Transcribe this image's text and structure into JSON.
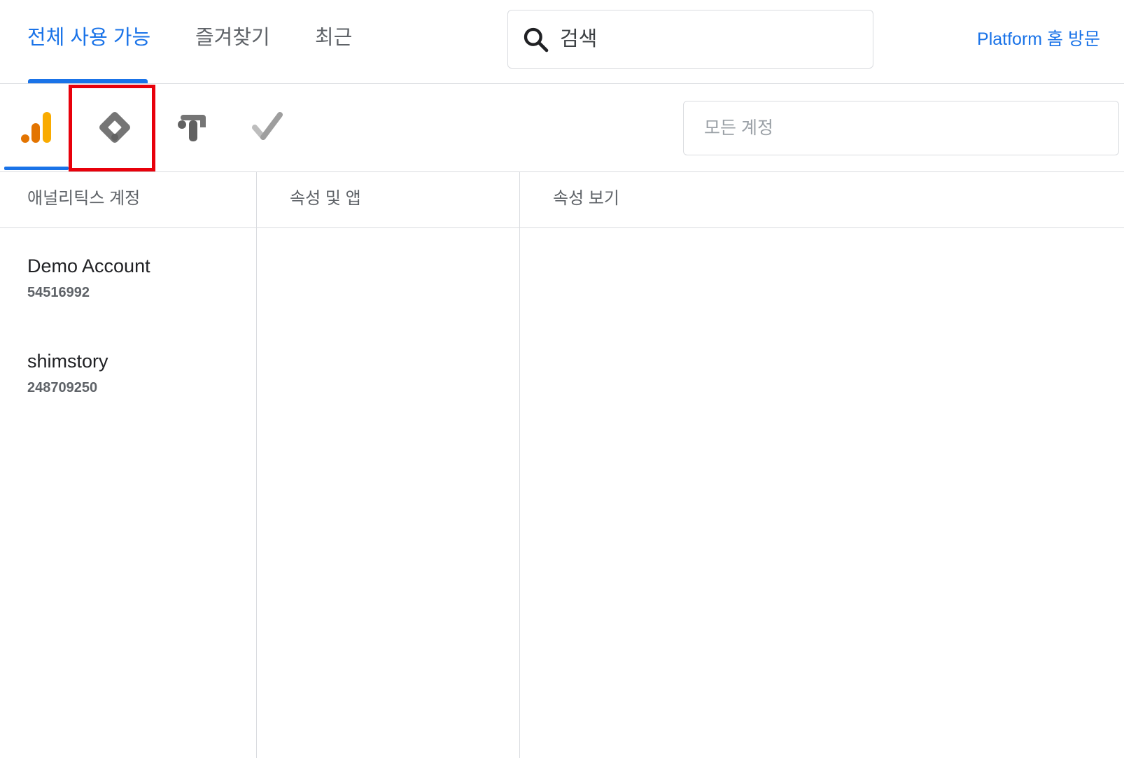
{
  "top_tabs": [
    {
      "label": "전체 사용 가능",
      "active": true
    },
    {
      "label": "즐겨찾기",
      "active": false
    },
    {
      "label": "최근",
      "active": false
    }
  ],
  "search": {
    "placeholder": "검색",
    "icon": "search-icon"
  },
  "platform_link": "Platform 홈 방문",
  "products": [
    {
      "icon": "analytics-icon",
      "active": true
    },
    {
      "icon": "tag-manager-icon",
      "active": false,
      "highlighted": true
    },
    {
      "icon": "optimize-icon",
      "active": false
    },
    {
      "icon": "surveys-icon",
      "active": false
    }
  ],
  "account_filter": {
    "placeholder": "모든 계정"
  },
  "columns": {
    "accounts": "애널리틱스 계정",
    "properties": "속성 및 앱",
    "views": "속성 보기"
  },
  "accounts": [
    {
      "name": "Demo Account",
      "id": "54516992"
    },
    {
      "name": "shimstory",
      "id": "248709250"
    }
  ],
  "colors": {
    "accent": "#1a73e8",
    "highlight": "#e8000b",
    "analytics_orange": "#f9ab00",
    "analytics_dark_orange": "#e37400"
  }
}
